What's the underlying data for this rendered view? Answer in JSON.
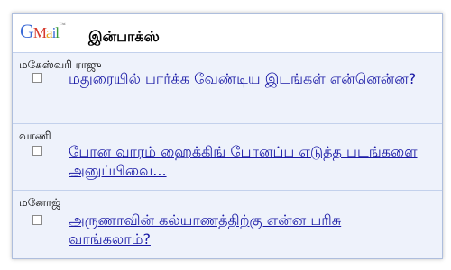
{
  "header": {
    "logo": {
      "g": "G",
      "m": "M",
      "a": "a",
      "i": "i",
      "l": "l",
      "tm": "™"
    },
    "title": "இன்பாக்ஸ்"
  },
  "messages": [
    {
      "sender": "மகேஸ்வரி ராஜு",
      "subject": "மதுரையில் பார்க்க வேண்டிய இடங்கள் என்னென்ன?"
    },
    {
      "sender": "வாணி",
      "subject": "போன வாரம் ஹைக்கிங் போனப்ப எடுத்த படங்களை அனுப்பிவை..."
    },
    {
      "sender": "மனோஜ்",
      "subject": "அருணாவின் கல்யாணத்திற்கு என்ன பரிசு வாங்கலாம்?"
    }
  ],
  "colors": {
    "link": "#1a1aa6",
    "row_bg": "#eef2fb",
    "border": "#aebedd"
  }
}
